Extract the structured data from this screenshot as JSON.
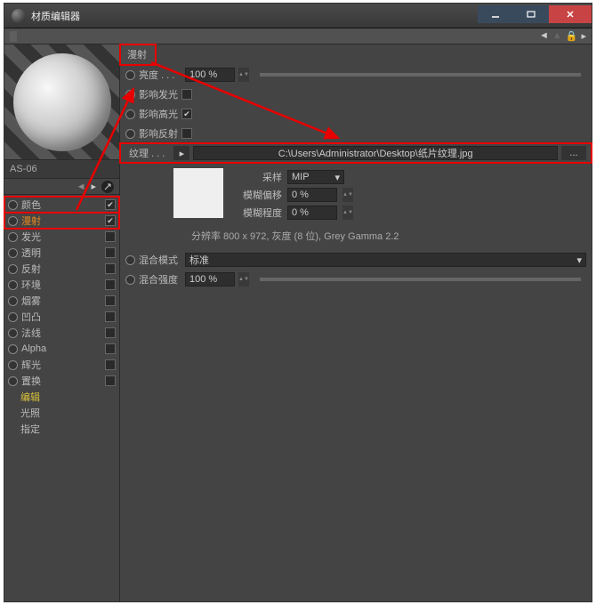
{
  "window": {
    "title": "材质编辑器"
  },
  "material": {
    "name": "AS-06"
  },
  "channels": [
    {
      "key": "color",
      "label": "颜色",
      "checked": true,
      "highlight": true
    },
    {
      "key": "diffuse",
      "label": "漫射",
      "checked": true,
      "highlight": true,
      "label_class": "orange"
    },
    {
      "key": "luminance",
      "label": "发光",
      "checked": false
    },
    {
      "key": "transparency",
      "label": "透明",
      "checked": false
    },
    {
      "key": "reflection",
      "label": "反射",
      "checked": false
    },
    {
      "key": "environment",
      "label": "环境",
      "checked": false
    },
    {
      "key": "fog",
      "label": "烟雾",
      "checked": false
    },
    {
      "key": "bump",
      "label": "凹凸",
      "checked": false
    },
    {
      "key": "normal",
      "label": "法线",
      "checked": false
    },
    {
      "key": "alpha",
      "label": "Alpha",
      "checked": false
    },
    {
      "key": "glow",
      "label": "辉光",
      "checked": false
    },
    {
      "key": "displacement",
      "label": "置换",
      "checked": false
    }
  ],
  "sub_items": [
    {
      "key": "edit",
      "label": "编辑",
      "class": "yellow"
    },
    {
      "key": "illumination",
      "label": "光照"
    },
    {
      "key": "assign",
      "label": "指定"
    }
  ],
  "section_title": "漫射",
  "brightness": {
    "label": "亮度",
    "value": "100 %"
  },
  "affect": {
    "luminance": {
      "label": "影响发光",
      "checked": false
    },
    "specular": {
      "label": "影响高光",
      "checked": true
    },
    "reflection": {
      "label": "影响反射",
      "checked": false
    }
  },
  "texture": {
    "label": "纹理",
    "path": "C:\\Users\\Administrator\\Desktop\\纸片纹理.jpg",
    "sampling_label": "采样",
    "sampling_value": "MIP",
    "blur_offset_label": "模糊偏移",
    "blur_offset_value": "0 %",
    "blur_scale_label": "模糊程度",
    "blur_scale_value": "0 %",
    "info": "分辨率 800 x 972, 灰度 (8 位), Grey Gamma 2.2"
  },
  "mix_mode": {
    "label": "混合模式",
    "value": "标准"
  },
  "mix_strength": {
    "label": "混合强度",
    "value": "100 %"
  },
  "icons": {
    "browse": "..."
  }
}
